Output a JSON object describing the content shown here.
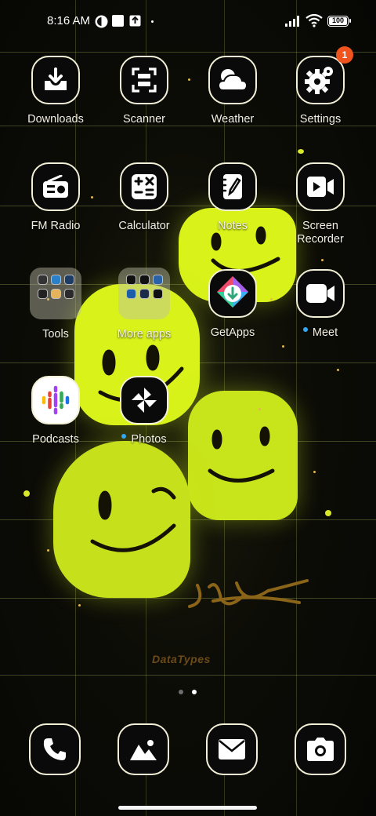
{
  "status_bar": {
    "time": "8:16 AM",
    "battery": "100",
    "icons": [
      "notification-app-icon",
      "notification-square-icon",
      "upload-arrow-icon",
      "dot-icon",
      "signal-icon",
      "wifi-icon",
      "battery-icon"
    ]
  },
  "apps": {
    "downloads": {
      "label": "Downloads",
      "icon": "download-tray-icon"
    },
    "scanner": {
      "label": "Scanner",
      "icon": "scan-frame-icon"
    },
    "weather": {
      "label": "Weather",
      "icon": "cloud-icon"
    },
    "settings": {
      "label": "Settings",
      "icon": "gear-icon",
      "badge": "1"
    },
    "fm_radio": {
      "label": "FM Radio",
      "icon": "radio-icon"
    },
    "calculator": {
      "label": "Calculator",
      "icon": "calculator-icon"
    },
    "notes": {
      "label": "Notes",
      "icon": "notepad-pen-icon"
    },
    "screen_recorder": {
      "label": "Screen\nRecorder",
      "icon": "video-record-icon"
    },
    "tools": {
      "label": "Tools",
      "icon": "folder-icon"
    },
    "more_apps": {
      "label": "More apps",
      "icon": "folder-icon"
    },
    "getapps": {
      "label": "GetApps",
      "icon": "getapps-icon"
    },
    "meet": {
      "label": "Meet",
      "icon": "video-camera-icon"
    },
    "podcasts": {
      "label": "Podcasts",
      "icon": "podcasts-icon"
    },
    "photos": {
      "label": "Photos",
      "icon": "pinwheel-icon"
    }
  },
  "dock": [
    {
      "name": "phone",
      "icon": "phone-icon"
    },
    {
      "name": "gallery",
      "icon": "landscape-icon"
    },
    {
      "name": "messages",
      "icon": "envelope-icon"
    },
    {
      "name": "camera",
      "icon": "camera-icon"
    }
  ],
  "pagination": {
    "total": 2,
    "current": 2
  },
  "wallpaper": {
    "watermark": "DataTypes",
    "accent": "#d8f21a"
  },
  "colors": {
    "badge": "#f0541e",
    "new_dot": "#35a6f0",
    "icon_outline": "#f3f0d8"
  }
}
